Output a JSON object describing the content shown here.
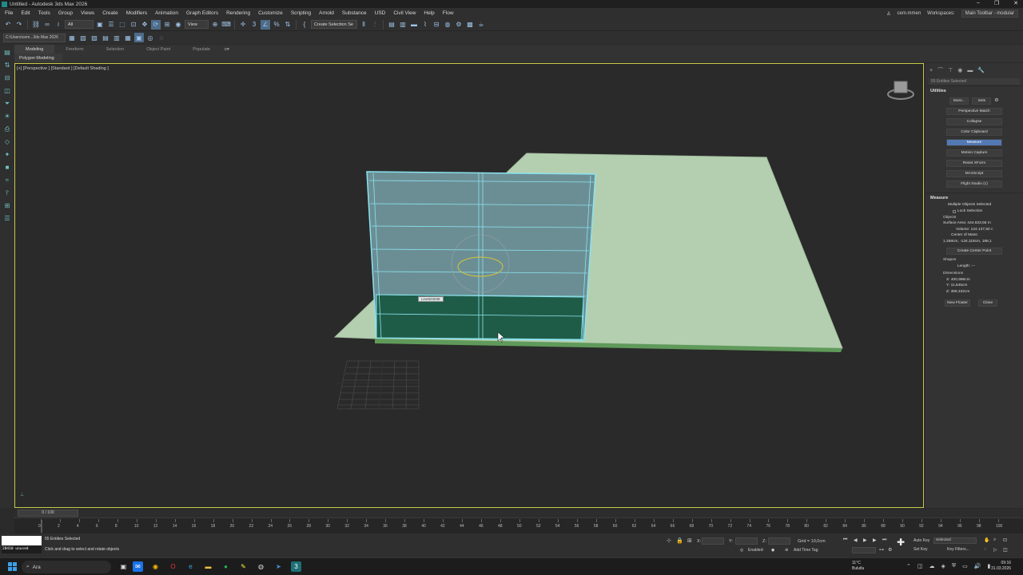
{
  "window": {
    "title": "Untitled - Autodesk 3ds Max 2026",
    "controls": [
      "–",
      "❐",
      "✕"
    ]
  },
  "menu": {
    "items": [
      "File",
      "Edit",
      "Tools",
      "Group",
      "Views",
      "Create",
      "Modifiers",
      "Animation",
      "Graph Editors",
      "Rendering",
      "Customize",
      "Scripting",
      "Arnold",
      "Substance",
      "USD",
      "Civil View",
      "Help",
      "Flow"
    ],
    "user": "cem.mmen",
    "workspaces_label": "Workspaces:",
    "workspace_value": "Main Toolbar - modular"
  },
  "toolbar": {
    "filter_value": "All",
    "refcoord_value": "View",
    "selection_set": "Create Selection Se",
    "path_value": "C:\\Users\\cem...3ds Max 2026"
  },
  "ribbon": {
    "tabs": [
      "Modeling",
      "Freeform",
      "Selection",
      "Object Paint",
      "Populate"
    ],
    "sub_label": "Polygon Modeling"
  },
  "viewport": {
    "label": "[+] [Perspective ] [Standard ] [Default Shading ]",
    "ruler_label": "Line823039"
  },
  "command_panel": {
    "selection_info": "55 Entities Selected",
    "utilities": {
      "title": "Utilities",
      "more": "More...",
      "sets": "Sets",
      "buttons": [
        "Perspective Match",
        "Collapse",
        "Color Clipboard",
        "Measure",
        "Motion Capture",
        "Reset XForm",
        "MAXScript",
        "Flight Studio (c)"
      ],
      "active_index": 3
    },
    "measure": {
      "title": "Measure",
      "multiple": "Multiple Objects Selected",
      "lock": "Lock Selection",
      "objects_label": "Objects",
      "surface_area": "Surface Area: 444.633,55 m",
      "volume": "Volume: 124.137,50 c",
      "center_label": "Center of Mass:",
      "center_value": "1.258cm, -134,118cm, 188,1",
      "create_center": "Create Center Point",
      "shapes_label": "Shapes",
      "length": "Length: ---",
      "dimensions_label": "Dimensions",
      "dim_x": "X: 400,996cm",
      "dim_y": "Y: 11,545cm",
      "dim_z": "Z: 359,332cm",
      "new_floater": "New Floater",
      "close": "Close"
    }
  },
  "timeline": {
    "slider_label": "0 / 100",
    "ticks": [
      "0",
      "2",
      "4",
      "6",
      "8",
      "10",
      "12",
      "14",
      "16",
      "18",
      "20",
      "22",
      "24",
      "26",
      "28",
      "30",
      "32",
      "34",
      "36",
      "38",
      "40",
      "42",
      "44",
      "46",
      "48",
      "50",
      "52",
      "54",
      "56",
      "58",
      "60",
      "62",
      "64",
      "66",
      "68",
      "70",
      "72",
      "74",
      "76",
      "78",
      "80",
      "82",
      "84",
      "86",
      "88",
      "90",
      "92",
      "94",
      "96",
      "98",
      "100"
    ]
  },
  "status": {
    "maxscript_text": "20410 unused",
    "entities": "55 Entities Selected",
    "prompt": "Click and drag to select and rotate objects",
    "x_label": "X:",
    "y_label": "Y:",
    "z_label": "Z:",
    "grid": "Grid = 10,0cm",
    "enabled": "Enabled:",
    "add_time_tag": "Add Time Tag",
    "auto_key": "Auto Key",
    "set_key": "Set Key",
    "key_mode": "Selected",
    "key_filters": "Key Filters..."
  },
  "taskbar": {
    "search": "Ara",
    "weather_temp": "11°C",
    "weather_desc": "Bulutlu",
    "time": "09:16",
    "date": "31.03.2026"
  }
}
